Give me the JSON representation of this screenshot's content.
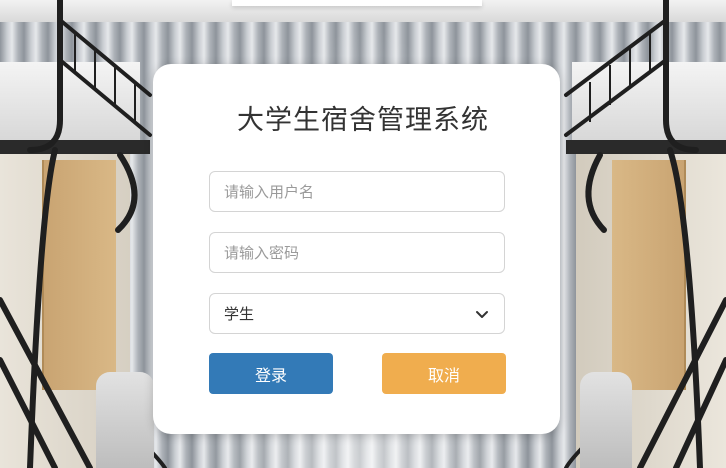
{
  "app": {
    "title": "大学生宿舍管理系统"
  },
  "login_form": {
    "username": {
      "value": "",
      "placeholder": "请输入用户名"
    },
    "password": {
      "value": "",
      "placeholder": "请输入密码"
    },
    "role_select": {
      "selected": "学生",
      "options": [
        "学生"
      ]
    },
    "buttons": {
      "login_label": "登录",
      "cancel_label": "取消"
    }
  },
  "colors": {
    "login_button": "#337ab7",
    "cancel_button": "#f0ad4e",
    "card_background": "#ffffff",
    "title_text": "#333333"
  },
  "icons": {
    "select_arrow": "chevron-down-icon"
  }
}
